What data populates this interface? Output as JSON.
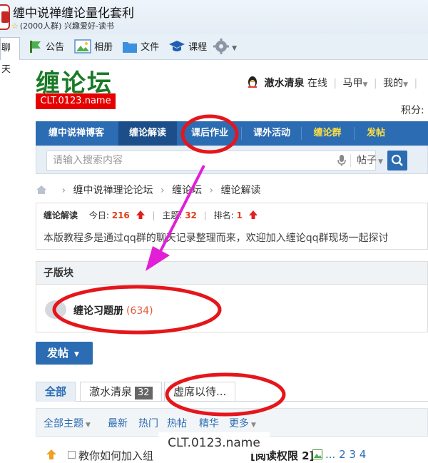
{
  "qq": {
    "group_name": "缠中说禅缠论量化套利",
    "group_info": "(2000人群) 兴趣爱好-读书",
    "tabs": [
      {
        "label": "聊天"
      },
      {
        "label": "公告"
      },
      {
        "label": "相册"
      },
      {
        "label": "文件"
      },
      {
        "label": "课程"
      }
    ]
  },
  "site": {
    "logo_text": "缠论坛",
    "logo_url": "CLT.0123.name"
  },
  "user": {
    "name": "澈水清泉",
    "status": "在线",
    "links": [
      "马甲",
      "我的"
    ],
    "score_label": "积分:"
  },
  "nav": {
    "items": [
      {
        "label": "缠中说禅博客"
      },
      {
        "label": "缠论解读"
      },
      {
        "label": "课后作业"
      },
      {
        "label": "课外活动"
      },
      {
        "label": "缠论群"
      },
      {
        "label": "发帖"
      }
    ]
  },
  "search": {
    "placeholder": "请输入搜索内容",
    "type": "帖子"
  },
  "breadcrumb": [
    "缠中说禅理论论坛",
    "缠论坛",
    "缠论解读"
  ],
  "forum": {
    "name": "缠论解读",
    "today_label": "今日:",
    "today_value": "216",
    "topics_label": "主题:",
    "topics_value": "32",
    "rank_label": "排名:",
    "rank_value": "1",
    "intro": "本版教程多是通过qq群的聊天记录整理而来，欢迎加入缠论qq群现场一起探讨"
  },
  "subforum": {
    "header": "子版块",
    "name": "缠论习题册",
    "count": "(634)"
  },
  "post_button": "发帖",
  "tabs": [
    {
      "label": "全部"
    },
    {
      "label": "澈水清泉",
      "count": "32"
    },
    {
      "label": "虚席以待..."
    }
  ],
  "filters": {
    "all_topics": "全部主题",
    "latest": "最新",
    "hot": "热门",
    "hot_post": "热帖",
    "featured": "精华",
    "more": "更多"
  },
  "thread": {
    "title_start": "教你如何加入组",
    "title_end": "[阅读权限 2]",
    "pages": "... 2 3 4"
  },
  "watermark": "CLT.0123.name",
  "colors": {
    "nav_blue": "#2b6cb3",
    "logo_green": "#1a7a26",
    "accent_red": "#e60000",
    "annotation_red": "#e5161b",
    "annotation_magenta": "#e21fd6"
  }
}
